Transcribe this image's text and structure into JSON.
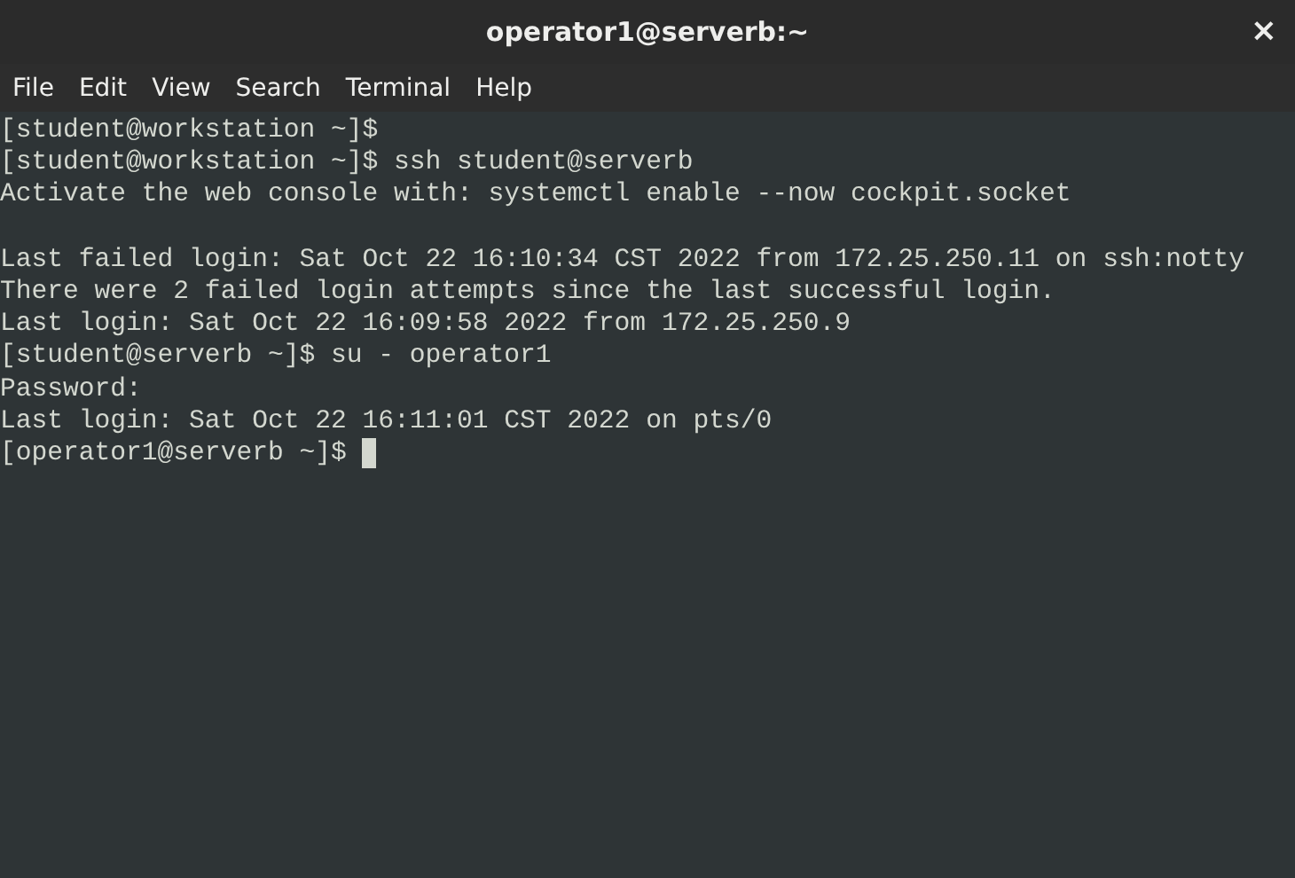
{
  "window": {
    "title": "operator1@serverb:~",
    "close": "×"
  },
  "menu": [
    {
      "label": "File"
    },
    {
      "label": "Edit"
    },
    {
      "label": "View"
    },
    {
      "label": "Search"
    },
    {
      "label": "Terminal"
    },
    {
      "label": "Help"
    }
  ],
  "terminal": {
    "lines": [
      {
        "kind": "text",
        "text": "[student@workstation ~]$"
      },
      {
        "kind": "text",
        "text": "[student@workstation ~]$ ssh student@serverb"
      },
      {
        "kind": "text",
        "text": "Activate the web console with: systemctl enable --now cockpit.socket"
      },
      {
        "kind": "blank"
      },
      {
        "kind": "text",
        "text": "Last failed login: Sat Oct 22 16:10:34 CST 2022 from 172.25.250.11 on ssh:notty"
      },
      {
        "kind": "text",
        "text": "There were 2 failed login attempts since the last successful login."
      },
      {
        "kind": "text",
        "text": "Last login: Sat Oct 22 16:09:58 2022 from 172.25.250.9"
      },
      {
        "kind": "text",
        "text": "[student@serverb ~]$ su - operator1"
      },
      {
        "kind": "text",
        "text": "Password:"
      },
      {
        "kind": "text",
        "text": "Last login: Sat Oct 22 16:11:01 CST 2022 on pts/0"
      },
      {
        "kind": "text",
        "text": "[operator1@serverb ~]$",
        "cursor": true
      }
    ]
  }
}
